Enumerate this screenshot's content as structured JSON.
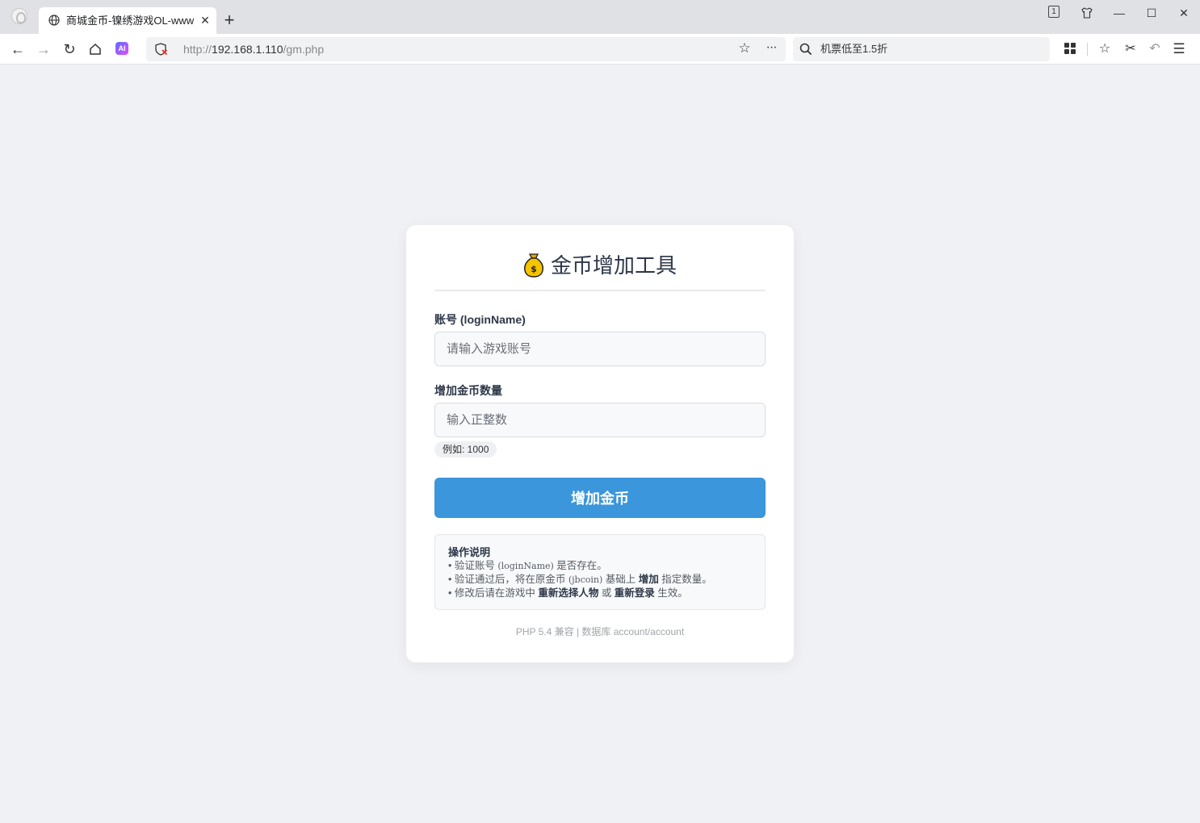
{
  "browser": {
    "tab_title": "商城金币-镍绣游戏OL-www.",
    "tab_count": "1",
    "url_scheme": "http://",
    "url_host": "192.168.1.110",
    "url_path": "/gm.php",
    "search_text": "机票低至1.5折"
  },
  "page": {
    "title": "金币增加工具",
    "account_label": "账号 (loginName)",
    "account_placeholder": "请输入游戏账号",
    "amount_label": "增加金币数量",
    "amount_placeholder": "输入正整数",
    "amount_hint": "例如: 1000",
    "submit_label": "增加金币",
    "notes": {
      "title": "操作说明",
      "line1_prefix": "• 验证账号 ",
      "line1_code": "(loginName)",
      "line1_suffix": " 是否存在。",
      "line2_prefix": "• 验证通过后，将在原金币 ",
      "line2_code": "(jbcoin)",
      "line2_mid": " 基础上 ",
      "line2_bold": "增加",
      "line2_suffix": " 指定数量。",
      "line3_prefix": "• 修改后请在游戏中 ",
      "line3_bold1": "重新选择人物",
      "line3_mid": " 或 ",
      "line3_bold2": "重新登录",
      "line3_suffix": " 生效。"
    },
    "footer": "PHP 5.4 兼容 | 数据库 account/account"
  }
}
